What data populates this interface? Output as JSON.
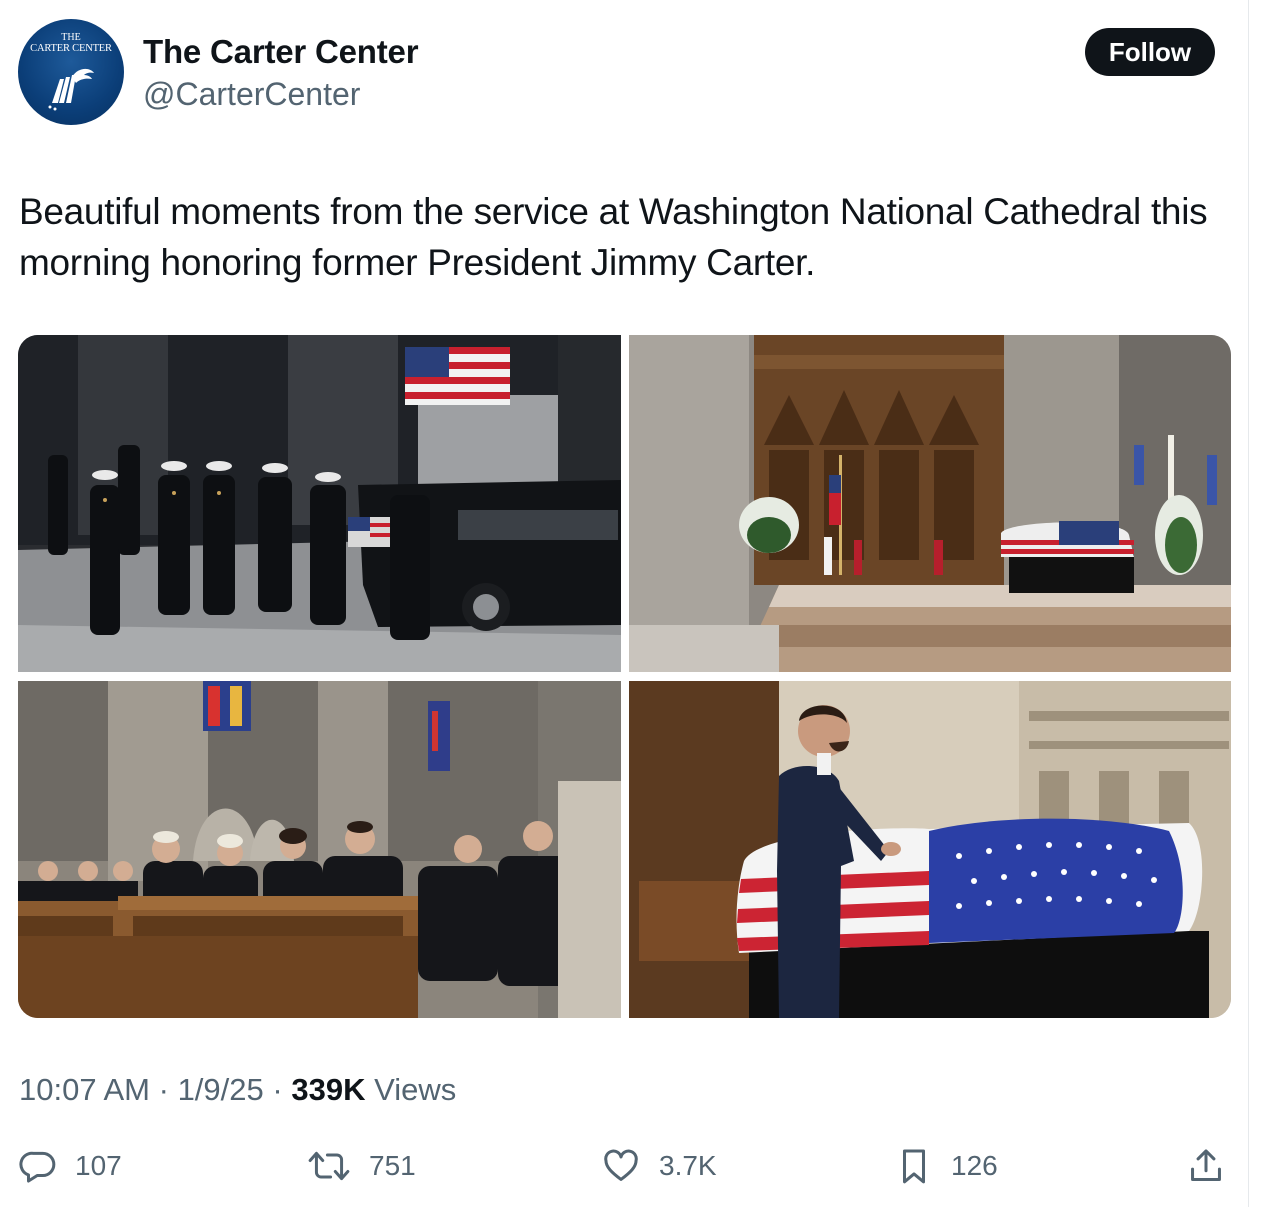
{
  "account": {
    "name": "The Carter Center",
    "handle": "@CarterCenter",
    "avatar_logo_line1": "THE",
    "avatar_logo_line2": "CARTER CENTER"
  },
  "follow_label": "Follow",
  "tweet": {
    "text": "Beautiful moments from the service at Washington National Cathedral this morning honoring former President Jimmy Carter."
  },
  "media": {
    "photos": [
      {
        "name": "honor-guard-photo"
      },
      {
        "name": "cathedral-altar-photo"
      },
      {
        "name": "pews-attendees-photo"
      },
      {
        "name": "flag-draped-casket-photo"
      }
    ]
  },
  "meta": {
    "time": "10:07 AM",
    "separator": "·",
    "date": "1/9/25",
    "views_count": "339K",
    "views_label": "Views"
  },
  "actions": {
    "replies": "107",
    "reposts": "751",
    "likes": "3.7K",
    "bookmarks": "126"
  },
  "colors": {
    "text": "#0f1419",
    "secondary": "#536471",
    "follow_bg": "#0f1419",
    "avatar_bg": "#0b3e78"
  },
  "icons": [
    "reply-icon",
    "repost-icon",
    "like-icon",
    "bookmark-icon",
    "share-icon"
  ]
}
